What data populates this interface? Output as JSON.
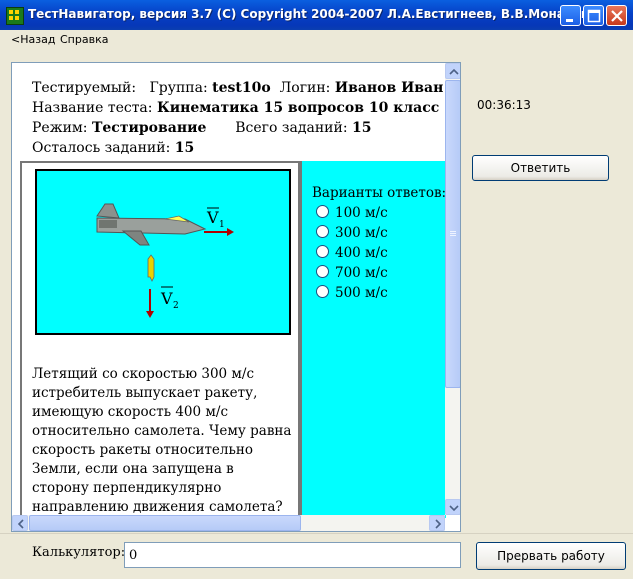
{
  "window": {
    "title": "ТестНавигатор, версия 3.7 (С) Copyright 2004-2007  Л.А.Евстигнеев, В.В.Монахов"
  },
  "menu": {
    "back": "<Назад",
    "help": "Справка"
  },
  "info": {
    "tested_label": "Тестируемый:",
    "group_label": "Группа:",
    "group_value": "test10o",
    "login_label": "Логин:",
    "login_value": "Иванов Иван",
    "test_name_label": "Название теста:",
    "test_name_value": "Кинематика 15 вопросов 10 класс",
    "mode_label": "Режим:",
    "mode_value": "Тестирование",
    "total_label": "Всего заданий:",
    "total_value": "15",
    "remaining_label": "Осталось заданий:",
    "remaining_value": "15"
  },
  "question": {
    "picture_labels": {
      "v1": "V",
      "v1_sub": "1",
      "v2": "V",
      "v2_sub": "2"
    },
    "text": "Летящий со скоростью 300 м/с истребитель выпускает ракету, имеющую скорость 400 м/с относительно самолета. Чему равна скорость ракеты относительно Земли, если она запущена в сторону перпендикулярно направлению движения самолета?"
  },
  "answers": {
    "title": "Варианты ответов:",
    "options": [
      "100 м/с",
      "300 м/с",
      "400 м/с",
      "700 м/с",
      "500 м/с"
    ]
  },
  "timer": "00:36:13",
  "buttons": {
    "answer": "Ответить",
    "abort": "Прервать работу"
  },
  "calculator": {
    "label": "Калькулятор:",
    "value": "0"
  },
  "colors": {
    "picture_bg": "#00ffff",
    "answers_bg": "#00ffff",
    "titlebar": "#0641c6"
  }
}
